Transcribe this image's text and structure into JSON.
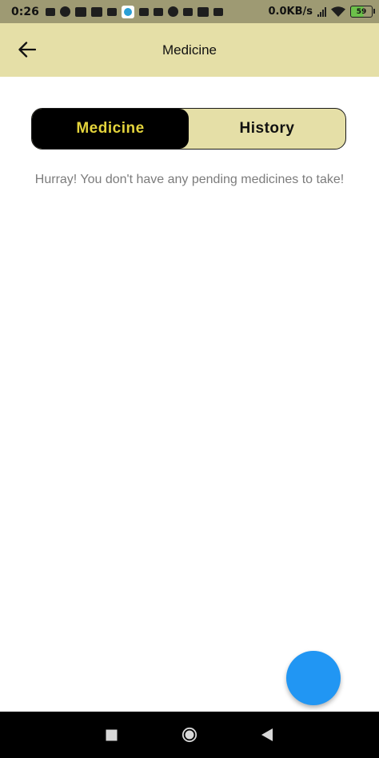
{
  "status_bar": {
    "time": "0:26",
    "network_speed": "0.0KB/s",
    "battery_level": "59"
  },
  "app_bar": {
    "title": "Medicine"
  },
  "tabs": [
    {
      "label": "Medicine",
      "active": true
    },
    {
      "label": "History",
      "active": false
    }
  ],
  "empty_state": {
    "message": "Hurray! You don't have any pending medicines to take!"
  },
  "colors": {
    "app_bar_bg": "#e5dfa7",
    "active_tab_bg": "#000000",
    "active_tab_text": "#e4d43c",
    "fab": "#2196f3"
  }
}
